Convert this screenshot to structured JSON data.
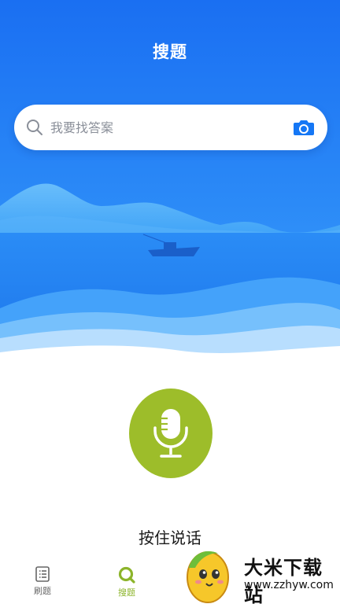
{
  "header": {
    "title": "搜题"
  },
  "search": {
    "placeholder": "我要找答案"
  },
  "voice": {
    "hint": "按住说话"
  },
  "tabbar": {
    "tabs": [
      {
        "label": "刷题",
        "icon": "list-icon",
        "active": false
      },
      {
        "label": "搜题",
        "icon": "search-tab-icon",
        "active": true
      }
    ]
  },
  "watermark": {
    "title": "大米下载站",
    "url": "www.zzhyw.com"
  },
  "colors": {
    "primary_blue": "#1577f5",
    "mic_green": "#9dbd2a",
    "active_tab": "#8cb42a",
    "camera_blue": "#1577f5"
  }
}
